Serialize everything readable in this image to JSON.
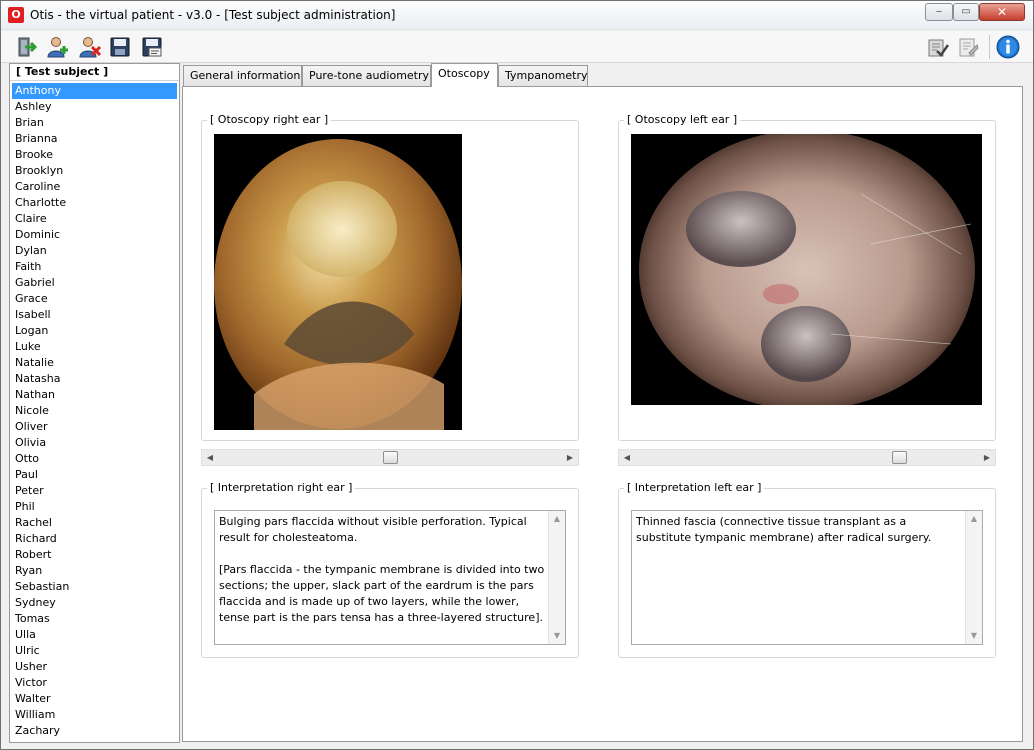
{
  "window": {
    "title": "Otis - the virtual patient - v3.0 - [Test subject administration]",
    "app_icon_letter": "O",
    "controls": {
      "minimize": "‒",
      "maximize": "▭",
      "close": "✕"
    }
  },
  "toolbar": {
    "icons": [
      "exit-icon",
      "add-user-icon",
      "remove-user-icon",
      "save-icon",
      "save-as-icon",
      "check-document-icon",
      "edit-document-icon",
      "info-icon"
    ]
  },
  "sidebar": {
    "header": "[ Test subject ]",
    "selected": "Anthony",
    "subjects": [
      "Anthony",
      "Ashley",
      "Brian",
      "Brianna",
      "Brooke",
      "Brooklyn",
      "Caroline",
      "Charlotte",
      "Claire",
      "Dominic",
      "Dylan",
      "Faith",
      "Gabriel",
      "Grace",
      "Isabell",
      "Logan",
      "Luke",
      "Natalie",
      "Natasha",
      "Nathan",
      "Nicole",
      "Oliver",
      "Olivia",
      "Otto",
      "Paul",
      "Peter",
      "Phil",
      "Rachel",
      "Richard",
      "Robert",
      "Ryan",
      "Sebastian",
      "Sydney",
      "Tomas",
      "Ulla",
      "Ulric",
      "Usher",
      "Victor",
      "Walter",
      "William",
      "Zachary"
    ]
  },
  "tabs": [
    {
      "label": "General information",
      "active": false
    },
    {
      "label": "Pure-tone audiometry",
      "active": false
    },
    {
      "label": "Otoscopy",
      "active": true
    },
    {
      "label": "Tympanometry",
      "active": false
    }
  ],
  "otoscopy": {
    "right_label": "[ Otoscopy right ear ]",
    "left_label": "[ Otoscopy left ear ]",
    "right_slider": 0.5,
    "left_slider": 0.78
  },
  "interpretation": {
    "right_label": "[ Interpretation right ear ]",
    "left_label": "[ Interpretation left ear ]",
    "right_text": [
      "Bulging pars flaccida without visible perforation.  Typical result for cholesteatoma.",
      "[Pars flaccida - the tympanic membrane is divided into two sections; the upper, slack part of the eardrum is the pars flaccida and is made up of two layers, while the  lower, tense part is the pars tensa has a three-layered structure]."
    ],
    "left_text": [
      "Thinned fascia (connective tissue transplant as a substitute tympanic membrane) after radical surgery."
    ]
  },
  "colors": {
    "selection": "#3399ff",
    "close_button": "#c73c2c",
    "info_blue": "#1a6fc9"
  }
}
